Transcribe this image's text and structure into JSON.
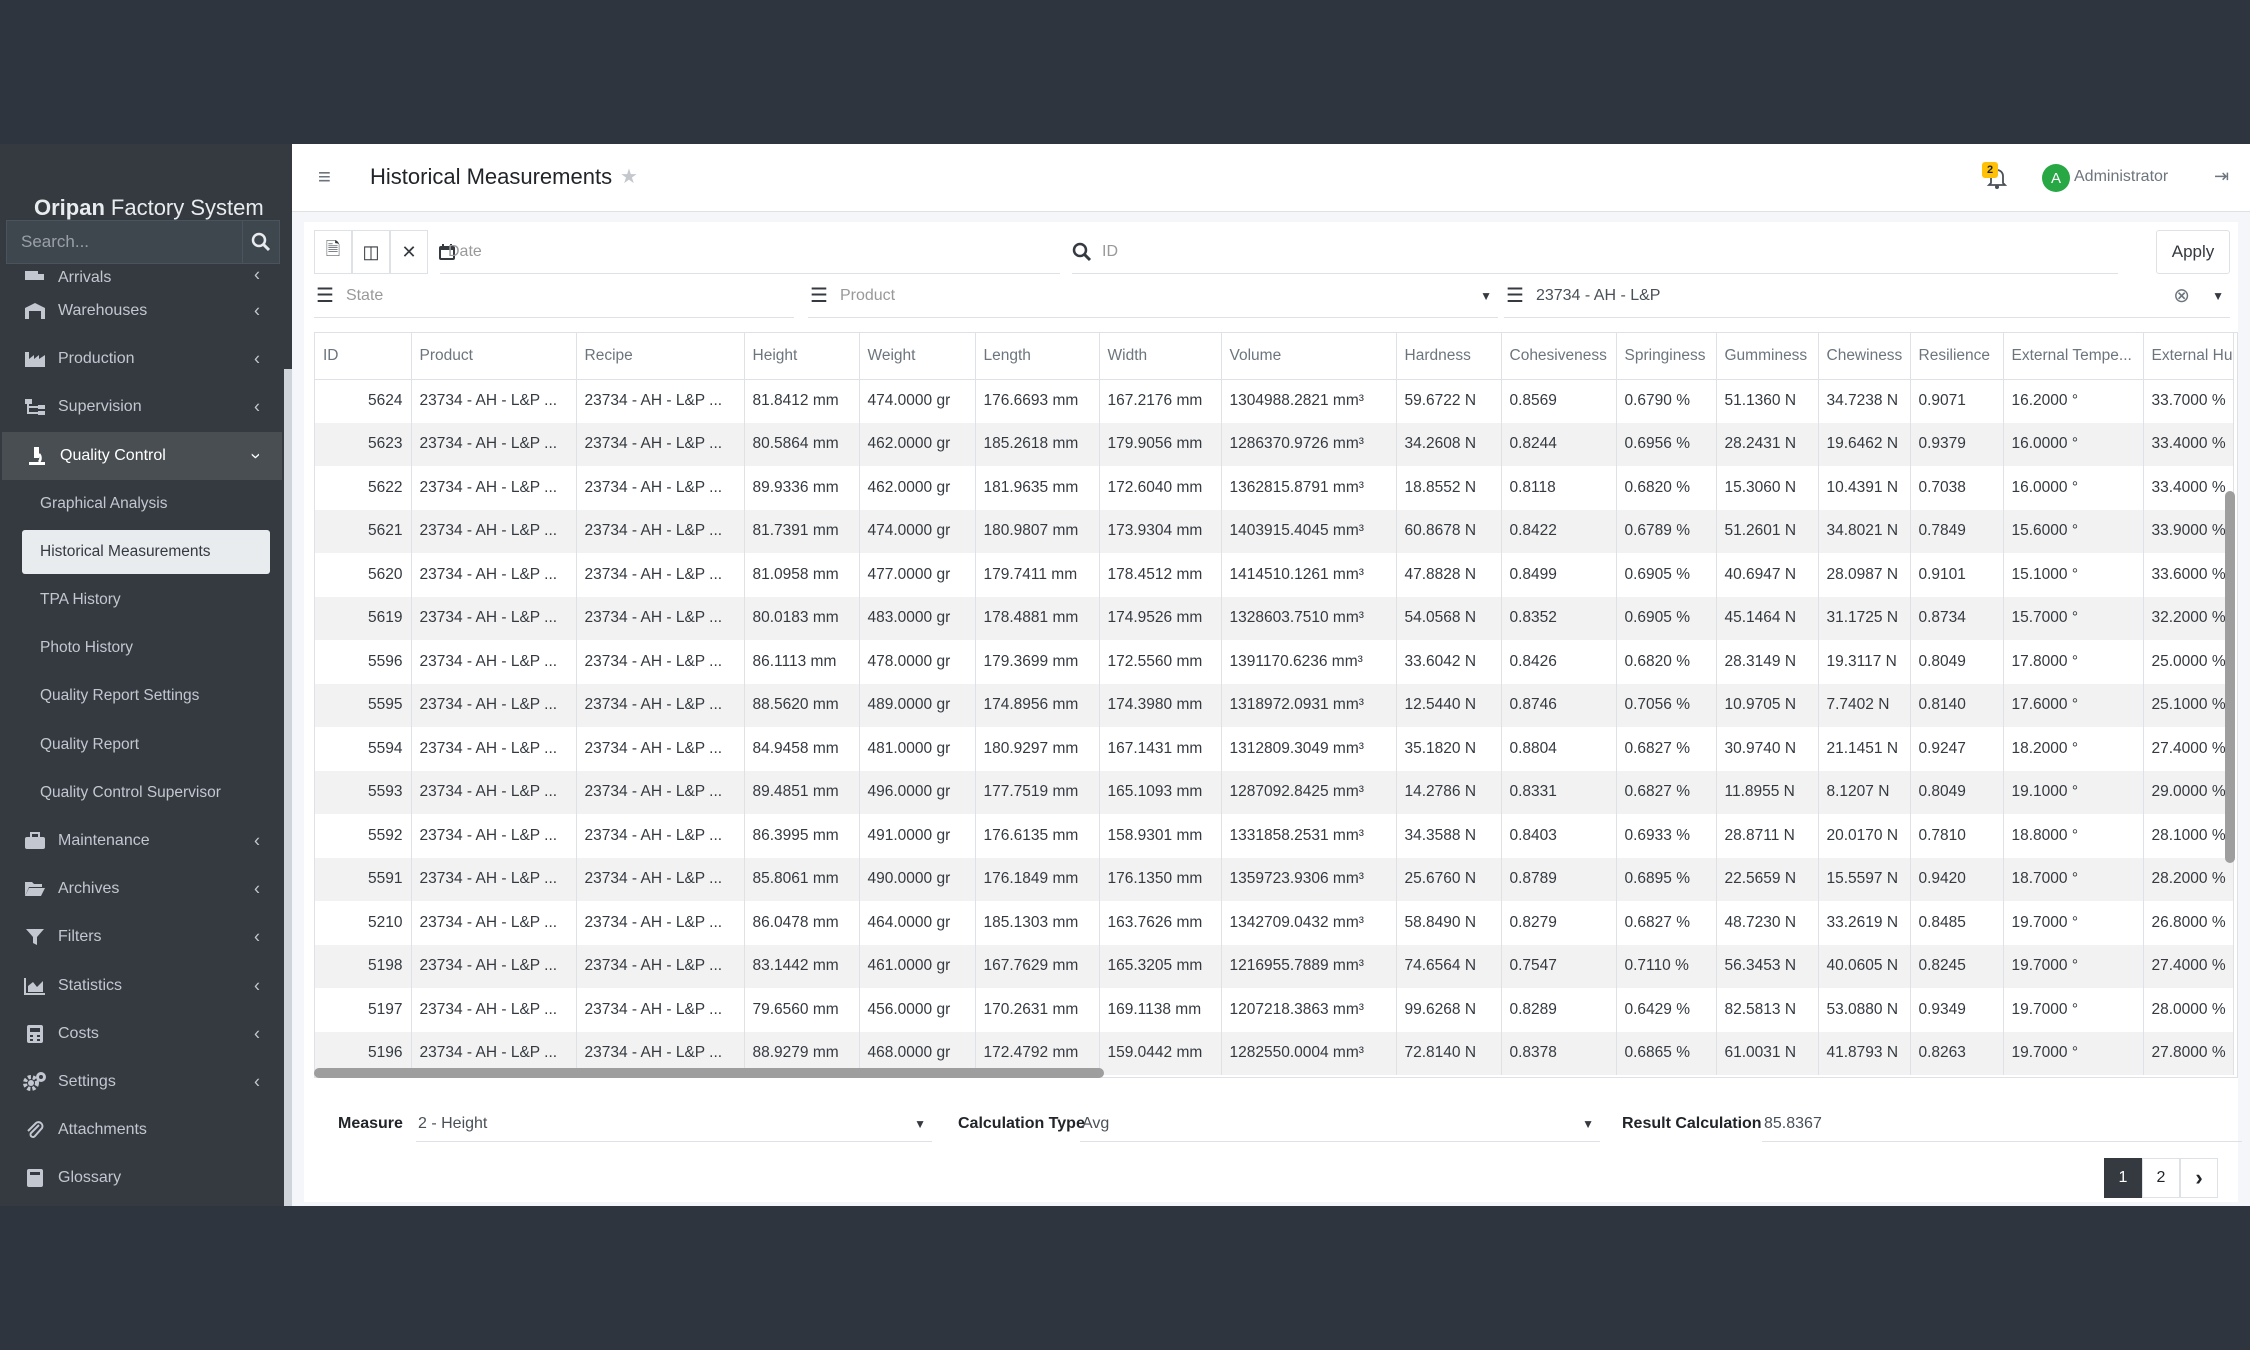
{
  "app": {
    "brand_bold": "Oripan",
    "brand_rest": "Factory System"
  },
  "search": {
    "placeholder": "Search..."
  },
  "sidebar": {
    "items": [
      {
        "label": "Arrivals",
        "icon": "truck-icon"
      },
      {
        "label": "Warehouses",
        "icon": "warehouse-icon"
      },
      {
        "label": "Production",
        "icon": "industry-icon"
      },
      {
        "label": "Supervision",
        "icon": "sitemap-icon"
      },
      {
        "label": "Quality Control",
        "icon": "microscope-icon"
      },
      {
        "label": "Maintenance",
        "icon": "toolbox-icon"
      },
      {
        "label": "Archives",
        "icon": "folder-open-icon"
      },
      {
        "label": "Filters",
        "icon": "filter-icon"
      },
      {
        "label": "Statistics",
        "icon": "chart-area-icon"
      },
      {
        "label": "Costs",
        "icon": "calculator-icon"
      },
      {
        "label": "Settings",
        "icon": "cogs-icon"
      },
      {
        "label": "Attachments",
        "icon": "paperclip-icon"
      },
      {
        "label": "Glossary",
        "icon": "book-icon"
      }
    ],
    "subitems": [
      "Graphical Analysis",
      "Historical Measurements",
      "TPA History",
      "Photo History",
      "Quality Report Settings",
      "Quality Report",
      "Quality Control Supervisor"
    ]
  },
  "header": {
    "title": "Historical Measurements",
    "notif_count": "2",
    "avatar_letter": "A",
    "user": "Administrator"
  },
  "filters": {
    "date_placeholder": "Date",
    "id_placeholder": "ID",
    "apply": "Apply",
    "state_placeholder": "State",
    "product_placeholder": "Product",
    "recipe_value": "23734 - AH - L&P"
  },
  "table": {
    "columns": [
      "ID",
      "Product",
      "Recipe",
      "Height",
      "Weight",
      "Length",
      "Width",
      "Volume",
      "Hardness",
      "Cohesiveness",
      "Springiness",
      "Gumminess",
      "Chewiness",
      "Resilience",
      "External Tempe...",
      "External Hu"
    ],
    "rows": [
      [
        "5624",
        "23734 - AH - L&P ...",
        "23734 - AH - L&P ...",
        "81.8412 mm",
        "474.0000 gr",
        "176.6693 mm",
        "167.2176 mm",
        "1304988.2821 mm³",
        "59.6722 N",
        "0.8569",
        "0.6790 %",
        "51.1360 N",
        "34.7238 N",
        "0.9071",
        "16.2000 °",
        "33.7000 %"
      ],
      [
        "5623",
        "23734 - AH - L&P ...",
        "23734 - AH - L&P ...",
        "80.5864 mm",
        "462.0000 gr",
        "185.2618 mm",
        "179.9056 mm",
        "1286370.9726 mm³",
        "34.2608 N",
        "0.8244",
        "0.6956 %",
        "28.2431 N",
        "19.6462 N",
        "0.9379",
        "16.0000 °",
        "33.4000 %"
      ],
      [
        "5622",
        "23734 - AH - L&P ...",
        "23734 - AH - L&P ...",
        "89.9336 mm",
        "462.0000 gr",
        "181.9635 mm",
        "172.6040 mm",
        "1362815.8791 mm³",
        "18.8552 N",
        "0.8118",
        "0.6820 %",
        "15.3060 N",
        "10.4391 N",
        "0.7038",
        "16.0000 °",
        "33.4000 %"
      ],
      [
        "5621",
        "23734 - AH - L&P ...",
        "23734 - AH - L&P ...",
        "81.7391 mm",
        "474.0000 gr",
        "180.9807 mm",
        "173.9304 mm",
        "1403915.4045 mm³",
        "60.8678 N",
        "0.8422",
        "0.6789 %",
        "51.2601 N",
        "34.8021 N",
        "0.7849",
        "15.6000 °",
        "33.9000 %"
      ],
      [
        "5620",
        "23734 - AH - L&P ...",
        "23734 - AH - L&P ...",
        "81.0958 mm",
        "477.0000 gr",
        "179.7411 mm",
        "178.4512 mm",
        "1414510.1261 mm³",
        "47.8828 N",
        "0.8499",
        "0.6905 %",
        "40.6947 N",
        "28.0987 N",
        "0.9101",
        "15.1000 °",
        "33.6000 %"
      ],
      [
        "5619",
        "23734 - AH - L&P ...",
        "23734 - AH - L&P ...",
        "80.0183 mm",
        "483.0000 gr",
        "178.4881 mm",
        "174.9526 mm",
        "1328603.7510 mm³",
        "54.0568 N",
        "0.8352",
        "0.6905 %",
        "45.1464 N",
        "31.1725 N",
        "0.8734",
        "15.7000 °",
        "32.2000 %"
      ],
      [
        "5596",
        "23734 - AH - L&P ...",
        "23734 - AH - L&P ...",
        "86.1113 mm",
        "478.0000 gr",
        "179.3699 mm",
        "172.5560 mm",
        "1391170.6236 mm³",
        "33.6042 N",
        "0.8426",
        "0.6820 %",
        "28.3149 N",
        "19.3117 N",
        "0.8049",
        "17.8000 °",
        "25.0000 %"
      ],
      [
        "5595",
        "23734 - AH - L&P ...",
        "23734 - AH - L&P ...",
        "88.5620 mm",
        "489.0000 gr",
        "174.8956 mm",
        "174.3980 mm",
        "1318972.0931 mm³",
        "12.5440 N",
        "0.8746",
        "0.7056 %",
        "10.9705 N",
        "7.7402 N",
        "0.8140",
        "17.6000 °",
        "25.1000 %"
      ],
      [
        "5594",
        "23734 - AH - L&P ...",
        "23734 - AH - L&P ...",
        "84.9458 mm",
        "481.0000 gr",
        "180.9297 mm",
        "167.1431 mm",
        "1312809.3049 mm³",
        "35.1820 N",
        "0.8804",
        "0.6827 %",
        "30.9740 N",
        "21.1451 N",
        "0.9247",
        "18.2000 °",
        "27.4000 %"
      ],
      [
        "5593",
        "23734 - AH - L&P ...",
        "23734 - AH - L&P ...",
        "89.4851 mm",
        "496.0000 gr",
        "177.7519 mm",
        "165.1093 mm",
        "1287092.8425 mm³",
        "14.2786 N",
        "0.8331",
        "0.6827 %",
        "11.8955 N",
        "8.1207 N",
        "0.8049",
        "19.1000 °",
        "29.0000 %"
      ],
      [
        "5592",
        "23734 - AH - L&P ...",
        "23734 - AH - L&P ...",
        "86.3995 mm",
        "491.0000 gr",
        "176.6135 mm",
        "158.9301 mm",
        "1331858.2531 mm³",
        "34.3588 N",
        "0.8403",
        "0.6933 %",
        "28.8711 N",
        "20.0170 N",
        "0.7810",
        "18.8000 °",
        "28.1000 %"
      ],
      [
        "5591",
        "23734 - AH - L&P ...",
        "23734 - AH - L&P ...",
        "85.8061 mm",
        "490.0000 gr",
        "176.1849 mm",
        "176.1350 mm",
        "1359723.9306 mm³",
        "25.6760 N",
        "0.8789",
        "0.6895 %",
        "22.5659 N",
        "15.5597 N",
        "0.9420",
        "18.7000 °",
        "28.2000 %"
      ],
      [
        "5210",
        "23734 - AH - L&P ...",
        "23734 - AH - L&P ...",
        "86.0478 mm",
        "464.0000 gr",
        "185.1303 mm",
        "163.7626 mm",
        "1342709.0432 mm³",
        "58.8490 N",
        "0.8279",
        "0.6827 %",
        "48.7230 N",
        "33.2619 N",
        "0.8485",
        "19.7000 °",
        "26.8000 %"
      ],
      [
        "5198",
        "23734 - AH - L&P ...",
        "23734 - AH - L&P ...",
        "83.1442 mm",
        "461.0000 gr",
        "167.7629 mm",
        "165.3205 mm",
        "1216955.7889 mm³",
        "74.6564 N",
        "0.7547",
        "0.7110 %",
        "56.3453 N",
        "40.0605 N",
        "0.8245",
        "19.7000 °",
        "27.4000 %"
      ],
      [
        "5197",
        "23734 - AH - L&P ...",
        "23734 - AH - L&P ...",
        "79.6560 mm",
        "456.0000 gr",
        "170.2631 mm",
        "169.1138 mm",
        "1207218.3863 mm³",
        "99.6268 N",
        "0.8289",
        "0.6429 %",
        "82.5813 N",
        "53.0880 N",
        "0.9349",
        "19.7000 °",
        "28.0000 %"
      ],
      [
        "5196",
        "23734 - AH - L&P ...",
        "23734 - AH - L&P ...",
        "88.9279 mm",
        "468.0000 gr",
        "172.4792 mm",
        "159.0442 mm",
        "1282550.0004 mm³",
        "72.8140 N",
        "0.8378",
        "0.6865 %",
        "61.0031 N",
        "41.8793 N",
        "0.8263",
        "19.7000 °",
        "27.8000 %"
      ]
    ]
  },
  "footer": {
    "measure_label": "Measure",
    "measure_value": "2 - Height",
    "calc_label": "Calculation Type",
    "calc_value": "Avg",
    "result_label": "Result Calculation",
    "result_value": "85.8367"
  },
  "pager": {
    "pages": [
      "1",
      "2"
    ],
    "next": "›"
  }
}
